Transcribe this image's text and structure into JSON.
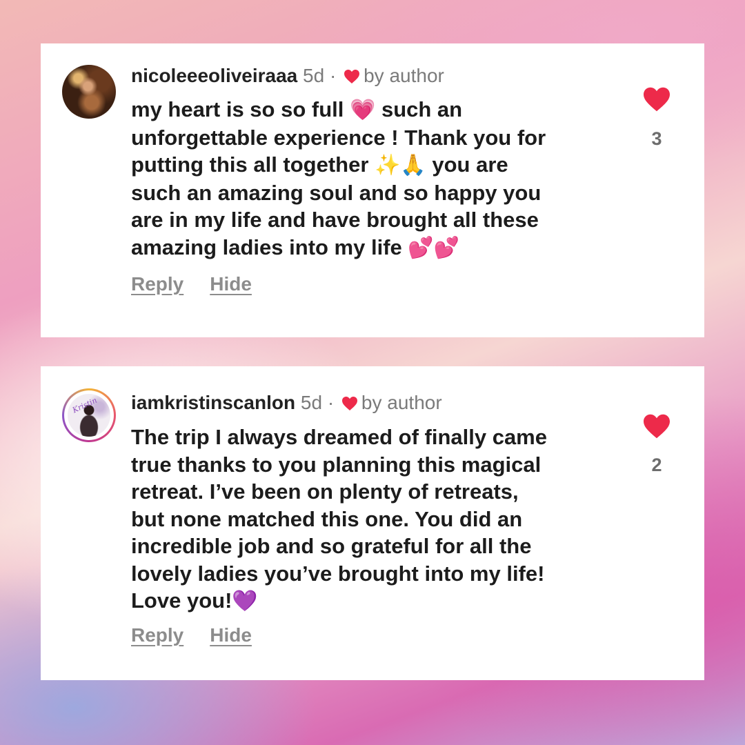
{
  "comments": [
    {
      "username": "nicoleeeoliveiraaa",
      "time": "5d",
      "separator": "·",
      "liked_by": "by author",
      "lines": [
        {
          "text": "my heart is so so full ",
          "emoji": "💗",
          "after": " such an"
        },
        {
          "text": "unforgettable experience ! Thank you for"
        },
        {
          "text": "putting this all together ",
          "emoji": "✨",
          "emoji2": "🙏",
          "after": " you are"
        },
        {
          "text": "such an amazing soul and so happy you"
        },
        {
          "text": "are in my life and have brought all these"
        },
        {
          "text": "amazing ladies into my life ",
          "emoji": "💕",
          "emoji2": "💕"
        }
      ],
      "reply_label": "Reply",
      "hide_label": "Hide",
      "like_count": "3"
    },
    {
      "username": "iamkristinscanlon",
      "time": "5d",
      "separator": "·",
      "liked_by": "by author",
      "lines": [
        {
          "text": "The trip I always dreamed of finally came"
        },
        {
          "text": "true thanks to you planning this magical"
        },
        {
          "text": "retreat. I’ve been on plenty of retreats,"
        },
        {
          "text": "but none matched this one. You did an"
        },
        {
          "text": "incredible job and so grateful for all the"
        },
        {
          "text": "lovely ladies you’ve brought into my life!"
        },
        {
          "text": "Love you!",
          "emoji": "💜"
        }
      ],
      "reply_label": "Reply",
      "hide_label": "Hide",
      "like_count": "2",
      "avatar_script": "Kristin"
    }
  ],
  "icons": {
    "heart": "heart-icon",
    "like": "like-heart-icon"
  },
  "colors": {
    "heart_red": "#ed2a4a",
    "meta_gray": "#7a7a7a",
    "action_gray": "#8c8c8c",
    "text_dark": "#1c1c1c"
  }
}
